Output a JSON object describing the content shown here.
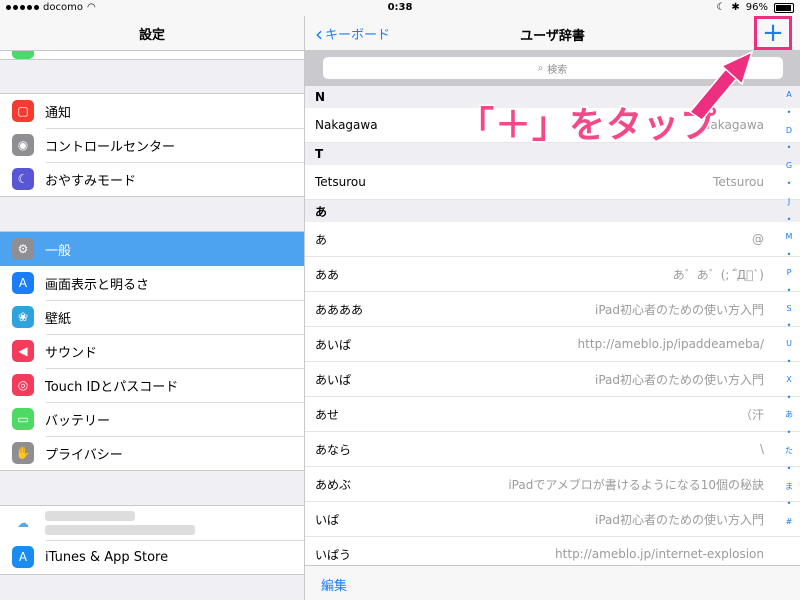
{
  "status": {
    "carrier": "docomo",
    "time": "0:38",
    "battery": "96%"
  },
  "left": {
    "title": "設定",
    "group1": [
      {
        "label": "通知",
        "icon": "notifications-icon",
        "color": "#f43b30"
      },
      {
        "label": "コントロールセンター",
        "icon": "control-center-icon",
        "color": "#8e8e93"
      },
      {
        "label": "おやすみモード",
        "icon": "do-not-disturb-icon",
        "color": "#5856d6"
      }
    ],
    "group2": [
      {
        "label": "一般",
        "icon": "gear-icon",
        "color": "#8e8e93",
        "selected": true
      },
      {
        "label": "画面表示と明るさ",
        "icon": "display-icon",
        "color": "#1a7ef8"
      },
      {
        "label": "壁紙",
        "icon": "wallpaper-icon",
        "color": "#2fa3dd"
      },
      {
        "label": "サウンド",
        "icon": "sound-icon",
        "color": "#f43b5c"
      },
      {
        "label": "Touch IDとパスコード",
        "icon": "fingerprint-icon",
        "color": "#f43b5c"
      },
      {
        "label": "バッテリー",
        "icon": "battery-icon",
        "color": "#4cd964"
      },
      {
        "label": "プライバシー",
        "icon": "privacy-hand-icon",
        "color": "#8e8e93"
      }
    ],
    "group3": [
      {
        "label": "",
        "icon": "cloud-icon",
        "color": "#ffffff"
      },
      {
        "label": "iTunes & App Store",
        "icon": "app-store-icon",
        "color": "#1a8cf0"
      }
    ]
  },
  "right": {
    "back_label": "キーボード",
    "title": "ユーザ辞書",
    "add_label": "+",
    "search_placeholder": "検索",
    "sections": [
      {
        "header": "N",
        "entries": [
          {
            "word": "Nakagawa",
            "reading": "Nakagawa"
          }
        ]
      },
      {
        "header": "T",
        "entries": [
          {
            "word": "Tetsurou",
            "reading": "Tetsurou"
          }
        ]
      },
      {
        "header": "あ",
        "entries": [
          {
            "word": "あ",
            "reading": "@"
          },
          {
            "word": "ああ",
            "reading": "あ゛あ゛(;´゚Д゚`)"
          },
          {
            "word": "ああああ",
            "reading": "iPad初心者のための使い方入門"
          },
          {
            "word": "あいぱ",
            "reading": "http://ameblo.jp/ipaddeameba/"
          },
          {
            "word": "あいぱ",
            "reading": "iPad初心者のための使い方入門"
          },
          {
            "word": "あせ",
            "reading": "（汗"
          },
          {
            "word": "あなら",
            "reading": "\\"
          },
          {
            "word": "あめぶ",
            "reading": "iPadでアメブロが書けるようになる10個の秘訣"
          },
          {
            "word": "いぱ",
            "reading": "iPad初心者のための使い方入門"
          },
          {
            "word": "いぱう",
            "reading": "http://ameblo.jp/internet-explosion"
          }
        ]
      }
    ],
    "index": [
      "A",
      "•",
      "D",
      "•",
      "G",
      "•",
      "J",
      "•",
      "M",
      "•",
      "P",
      "•",
      "S",
      "•",
      "U",
      "•",
      "X",
      "•",
      "あ",
      "•",
      "た",
      "•",
      "ま",
      "•",
      "#"
    ],
    "edit_label": "編集"
  },
  "annotation": {
    "text": "「＋」をタップ",
    "color": "#f44889"
  }
}
